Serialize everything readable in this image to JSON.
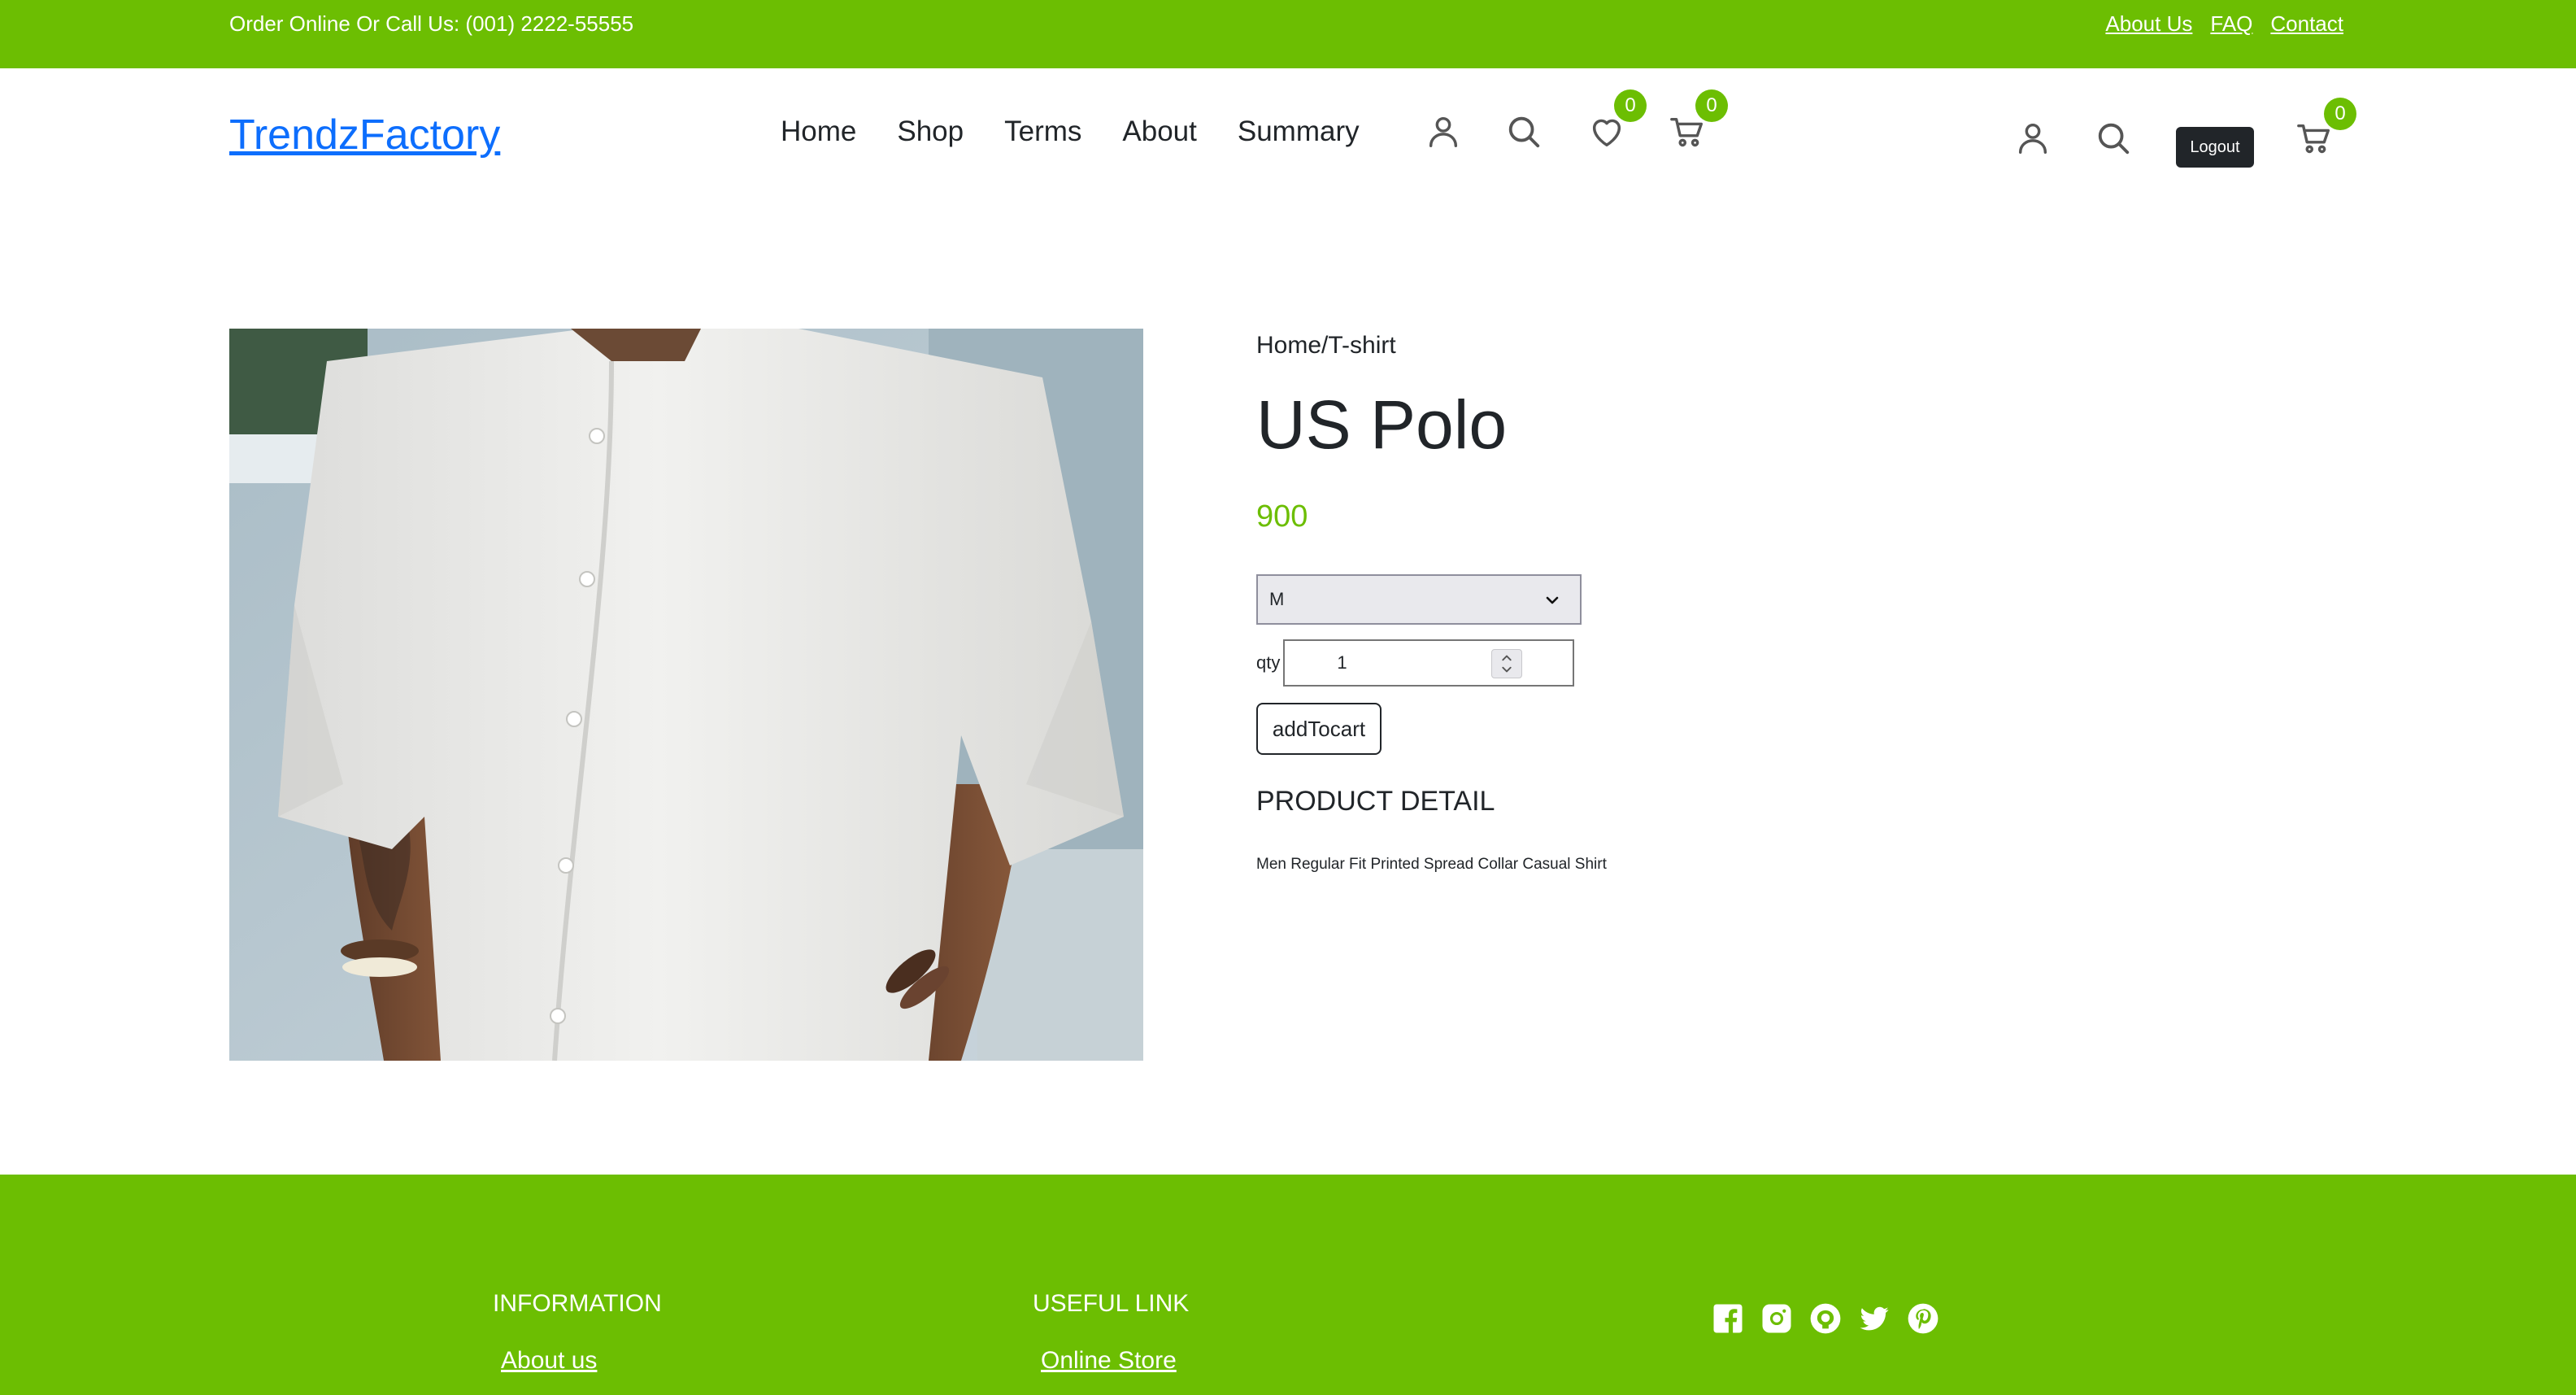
{
  "topbar": {
    "contact_text": "Order Online Or Call Us: (001) 2222-55555",
    "links": [
      "About Us",
      "FAQ",
      "Contact"
    ]
  },
  "header": {
    "brand": "TrendzFactory",
    "nav": [
      "Home",
      "Shop",
      "Terms",
      "About",
      "Summary"
    ],
    "wishlist_count": "0",
    "cart_count": "0",
    "cart_count_right": "0",
    "logout_label": "Logout"
  },
  "product": {
    "breadcrumb_home": "Home",
    "breadcrumb_sep": "/",
    "breadcrumb_category": "T-shirt",
    "title": "US Polo",
    "price": "900",
    "size_selected": "M",
    "qty_label": "qty",
    "qty_value": "1",
    "add_to_cart_label": "addTocart",
    "detail_heading": "PRODUCT DETAIL",
    "detail_text": "Men Regular Fit Printed Spread Collar Casual Shirt",
    "image_icon": "product-photo-white-shirt"
  },
  "footer": {
    "information_heading": "INFORMATION",
    "information_link": "About us",
    "useful_heading": "USEFUL LINK",
    "useful_link": "Online Store",
    "social_icons": [
      "facebook-icon",
      "instagram-icon",
      "github-icon",
      "twitter-icon",
      "pinterest-icon"
    ]
  },
  "colors": {
    "accent": "#6cbe02",
    "brand_link": "#0d6efd",
    "dark": "#212529"
  }
}
